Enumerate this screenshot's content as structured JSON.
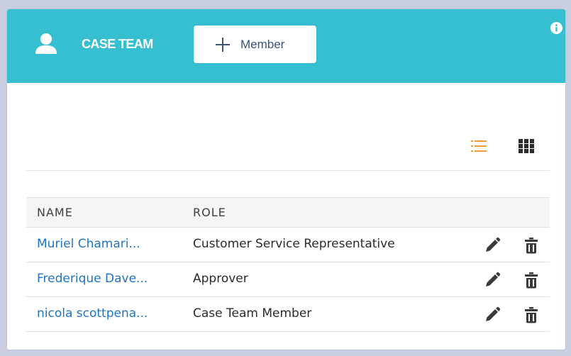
{
  "header": {
    "title": "CASE TEAM",
    "add_button_label": "Member",
    "icon": "user-icon",
    "info_icon": "info-icon",
    "accent_color": "#35bfd0"
  },
  "view_toggle": {
    "list_icon": "list-view-icon",
    "grid_icon": "grid-view-icon",
    "active": "list",
    "active_color": "#f39c34"
  },
  "table": {
    "columns": [
      "NAME",
      "ROLE"
    ],
    "rows": [
      {
        "name": "Muriel Chamari...",
        "role": "Customer Service Representative"
      },
      {
        "name": "Frederique Dave...",
        "role": "Approver"
      },
      {
        "name": "nicola scottpena...",
        "role": "Case Team Member"
      }
    ],
    "row_actions": [
      "edit-icon",
      "delete-icon"
    ]
  }
}
